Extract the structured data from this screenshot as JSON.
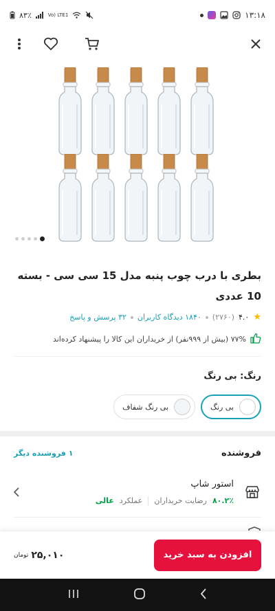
{
  "status_bar": {
    "time": "۱۳:۱۸",
    "battery": "۸۳٪",
    "network": "Vo) LTE1"
  },
  "toolbar": {
    "close_icon": "close-icon",
    "cart_icon": "cart-icon",
    "wishlist_icon": "heart-icon",
    "more_icon": "more-vertical-icon"
  },
  "gallery": {
    "dot_count": 5,
    "active_index": 0
  },
  "product": {
    "title": "بطری با درب چوب پنبه مدل 15 سی سی - بسته 10 عددی",
    "rating": "۴.۰",
    "rating_count": "(۲۷۶۰)",
    "reviews": "۱۸۴۰ دیدگاه کاربران",
    "questions": "۳۲ پرسش و پاسخ",
    "recommend": "۷۷% (بیش از ۹۹۹نفر) از خریداران این کالا را پیشنهاد کرده‌اند"
  },
  "color": {
    "label": "رنگ: بی رنگ",
    "options": [
      {
        "label": "بی رنگ",
        "selected": true
      },
      {
        "label": "بی رنگ شفاف",
        "selected": false
      }
    ]
  },
  "seller": {
    "title": "فروشنده",
    "other_sellers": "۱ فروشنده دیگر",
    "name": "استور شاپ",
    "satisfaction_value": "۸۰.۲٪",
    "satisfaction_label": "رضایت خریداران",
    "performance_label": "عملکرد",
    "performance_value": "عالی"
  },
  "buy_bar": {
    "add_button": "افزودن به سبد خرید",
    "price": "۲۵,۰۱۰",
    "currency": "تومان"
  },
  "colors": {
    "accent": "#19a0b5",
    "primary_red": "#e6123d",
    "success_green": "#00a049",
    "star": "#f9bc00"
  }
}
